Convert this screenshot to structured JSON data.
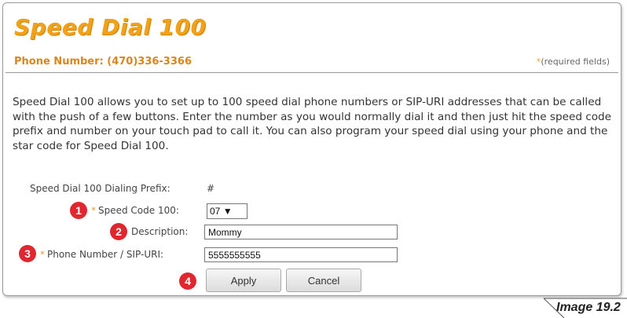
{
  "page": {
    "title": "Speed Dial 100",
    "phone_number": "Phone Number: (470)336-3366",
    "required_star": "*",
    "required_note": "(required fields)",
    "description": "Speed Dial 100 allows you to set up to 100 speed dial phone numbers or SIP-URI addresses that can be called with the push of a few buttons. Enter the number as you would normally dial it and then just hit the speed code prefix and number on your touch pad to call it. You can also program your speed dial using your phone and the star code for Speed Dial 100."
  },
  "form": {
    "prefix_label": "Speed Dial 100 Dialing Prefix:",
    "prefix_value": "#",
    "speed_code_label": "Speed Code 100:",
    "speed_code_value": "07",
    "description_label": "Description:",
    "description_value": "Mommy",
    "phone_label": "Phone Number / SIP-URI:",
    "phone_value": "5555555555",
    "required_star": "*",
    "apply_label": "Apply",
    "cancel_label": "Cancel"
  },
  "badges": [
    "1",
    "2",
    "3",
    "4"
  ],
  "caption": "Image 19.2",
  "colors": {
    "title": "#f0a21a",
    "phone": "#d9861b",
    "badge": "#e0262e",
    "asterisk": "#e8a030"
  }
}
